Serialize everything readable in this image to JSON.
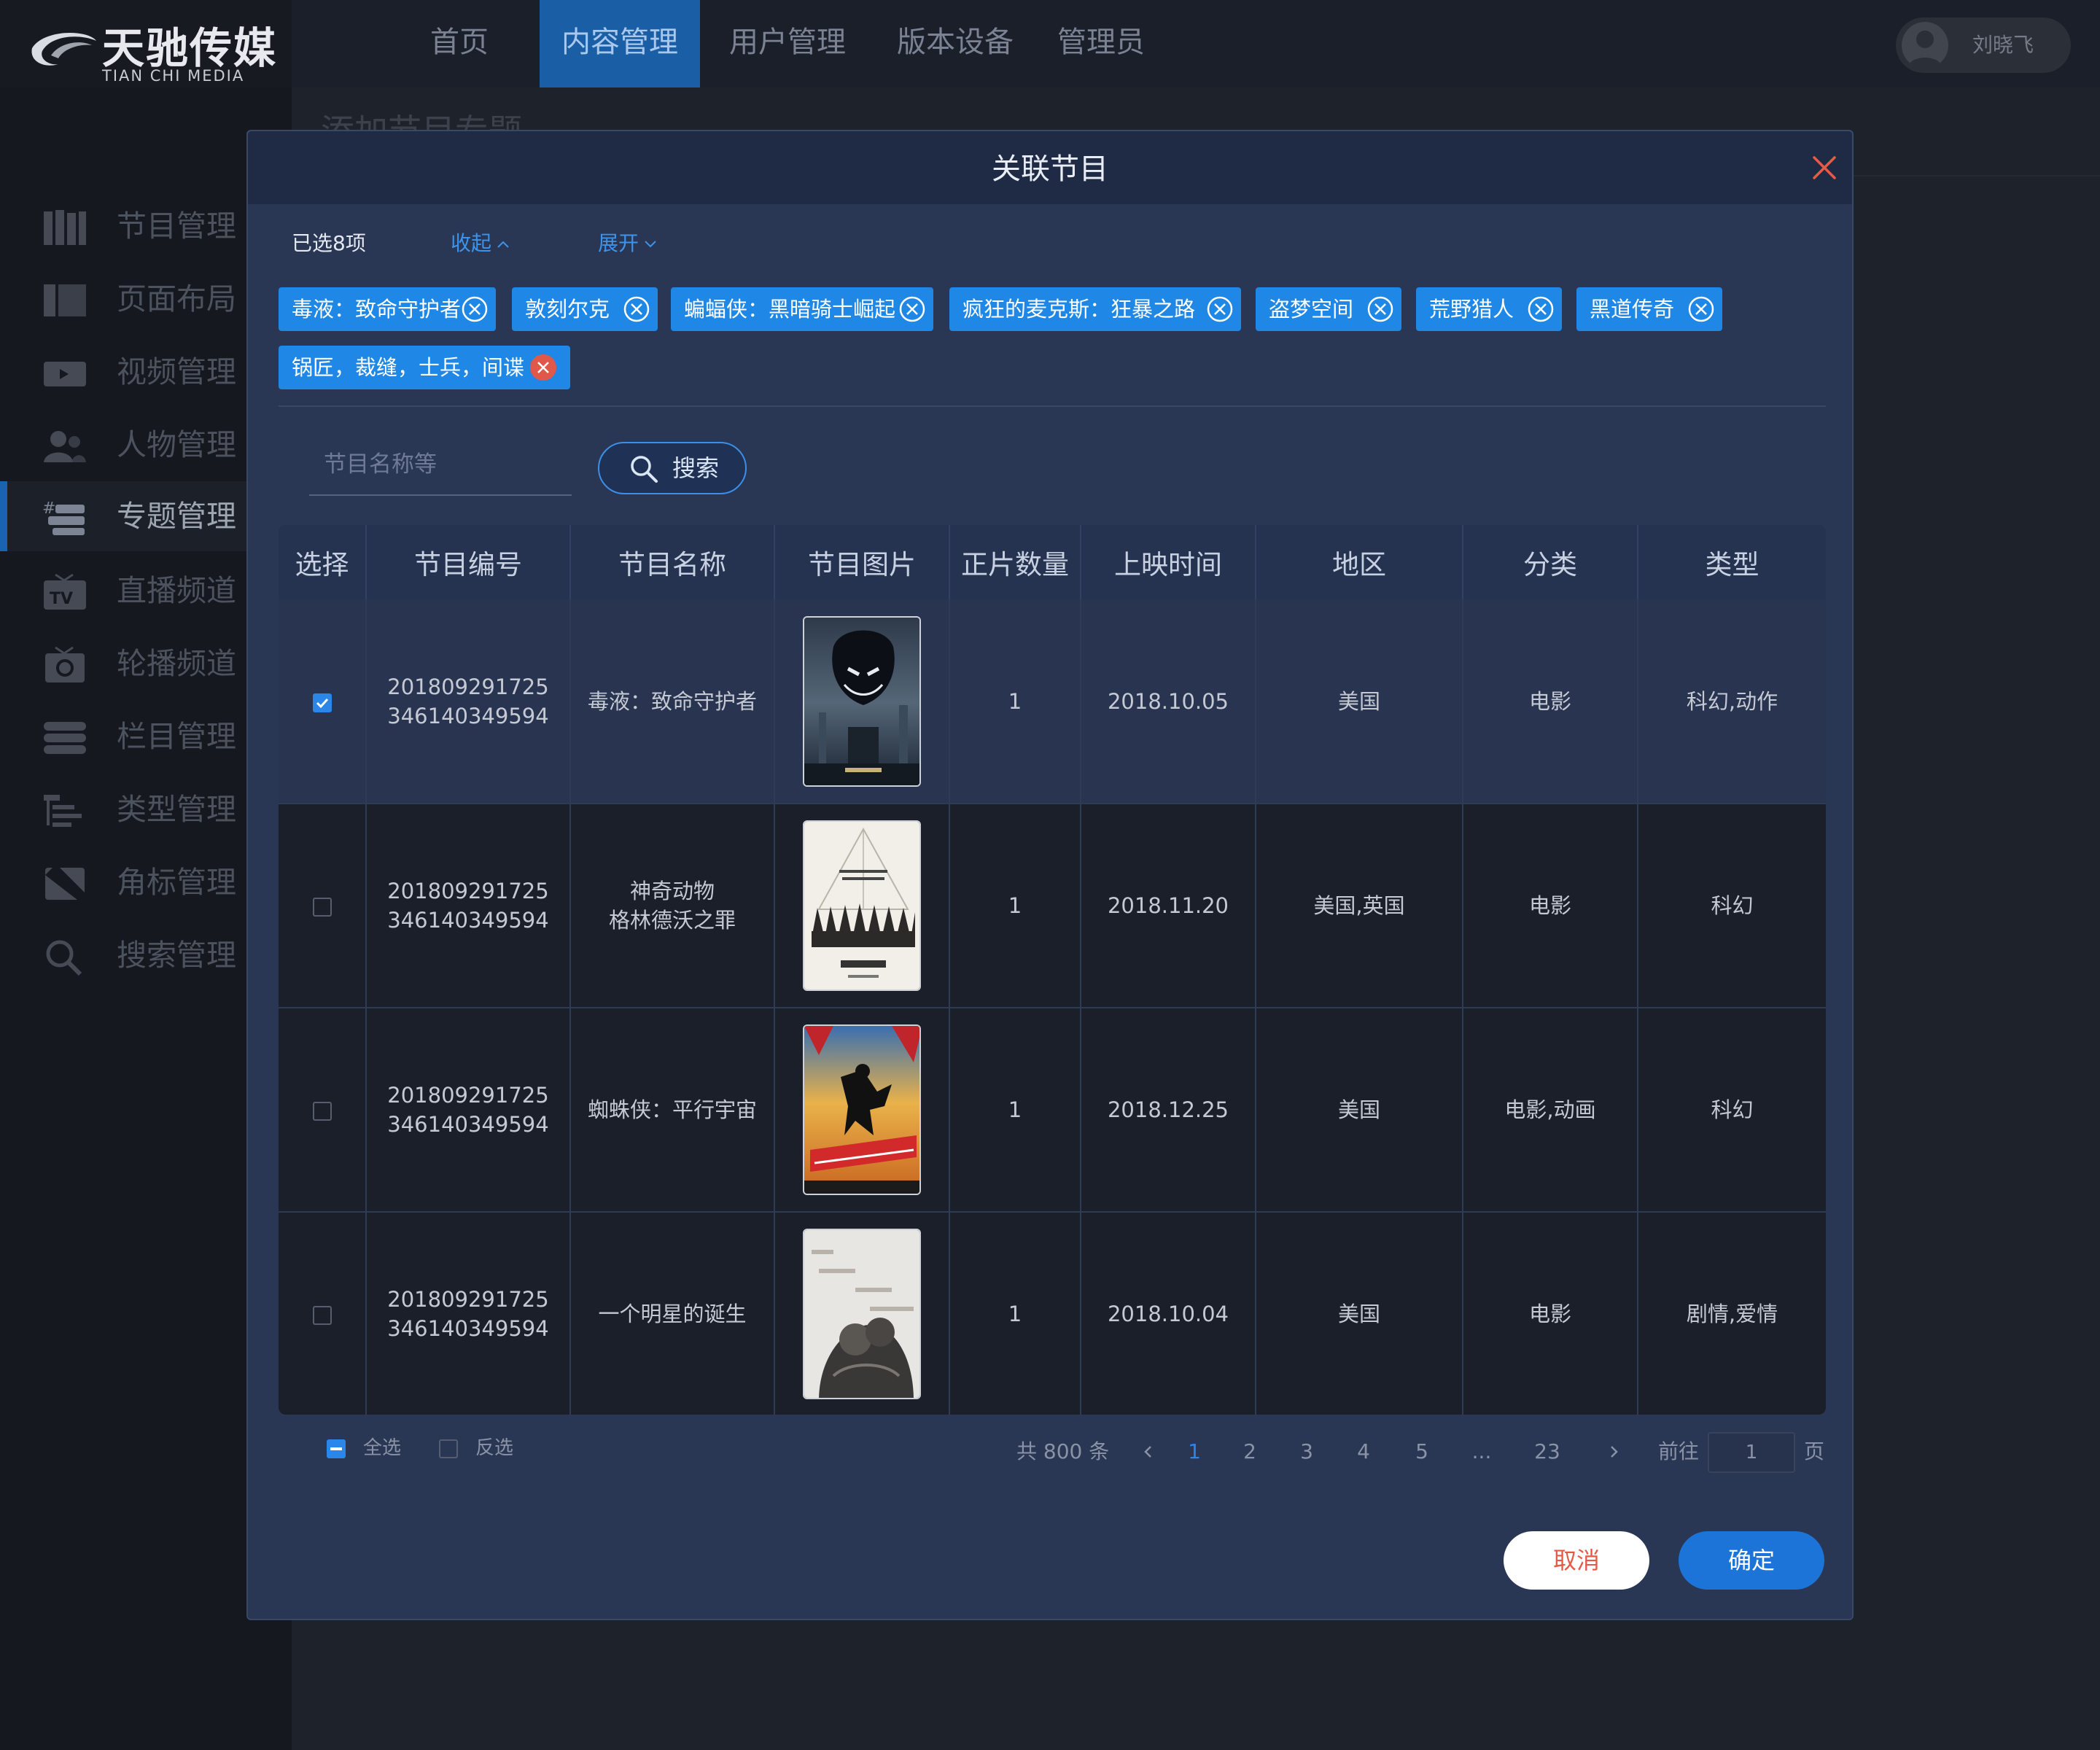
{
  "app": {
    "logo_title": "天驰传媒",
    "logo_sub": "TIAN CHI MEDIA"
  },
  "top_nav": [
    "首页",
    "内容管理",
    "用户管理",
    "版本设备",
    "管理员"
  ],
  "user": {
    "name": "刘晓飞"
  },
  "sidebar": {
    "items": [
      {
        "label": "节目管理",
        "icon": "film-icon"
      },
      {
        "label": "页面布局",
        "icon": "layout-icon"
      },
      {
        "label": "视频管理",
        "icon": "video-icon"
      },
      {
        "label": "人物管理",
        "icon": "people-icon"
      },
      {
        "label": "专题管理",
        "icon": "topic-icon"
      },
      {
        "label": "直播频道",
        "icon": "tv-icon"
      },
      {
        "label": "轮播频道",
        "icon": "carousel-icon"
      },
      {
        "label": "栏目管理",
        "icon": "column-icon"
      },
      {
        "label": "类型管理",
        "icon": "tree-icon"
      },
      {
        "label": "角标管理",
        "icon": "badge-icon"
      },
      {
        "label": "搜索管理",
        "icon": "search-icon"
      }
    ]
  },
  "background": {
    "page_title": "添加节目专题"
  },
  "modal": {
    "title": "关联节目",
    "selected_count": "已选8项",
    "collapse_label": "收起",
    "expand_label": "展开",
    "tags": [
      "毒液：致命守护者",
      "敦刻尔克",
      "蝙蝠侠：黑暗骑士崛起",
      "疯狂的麦克斯：狂暴之路",
      "盗梦空间",
      "荒野猎人",
      "黑道传奇",
      "锅匠，裁缝，士兵，间谍"
    ],
    "search": {
      "placeholder": "节目名称等",
      "button": "搜索"
    },
    "table": {
      "headers": [
        "选择",
        "节目编号",
        "节目名称",
        "节目图片",
        "正片数量",
        "上映时间",
        "地区",
        "分类",
        "类型"
      ],
      "rows": [
        {
          "id_line1": "201809291725",
          "id_line2": "346140349594",
          "name_line1": "毒液：致命守护者",
          "name_line2": "",
          "count": "1",
          "date": "2018.10.05",
          "region": "美国",
          "category": "电影",
          "genre": "科幻,动作",
          "checked": true
        },
        {
          "id_line1": "201809291725",
          "id_line2": "346140349594",
          "name_line1": "神奇动物",
          "name_line2": "格林德沃之罪",
          "count": "1",
          "date": "2018.11.20",
          "region": "美国,英国",
          "category": "电影",
          "genre": "科幻",
          "checked": false
        },
        {
          "id_line1": "201809291725",
          "id_line2": "346140349594",
          "name_line1": "蜘蛛侠：平行宇宙",
          "name_line2": "",
          "count": "1",
          "date": "2018.12.25",
          "region": "美国",
          "category": "电影,动画",
          "genre": "科幻",
          "checked": false
        },
        {
          "id_line1": "201809291725",
          "id_line2": "346140349594",
          "name_line1": "一个明星的诞生",
          "name_line2": "",
          "count": "1",
          "date": "2018.10.04",
          "region": "美国",
          "category": "电影",
          "genre": "剧情,爱情",
          "checked": false
        }
      ]
    },
    "footer": {
      "select_all": "全选",
      "invert": "反选",
      "total": "共 800 条",
      "pages": [
        "1",
        "2",
        "3",
        "4",
        "5",
        "...",
        "23"
      ],
      "current_page": "1",
      "goto_label": "前往",
      "goto_value": "1",
      "page_unit": "页"
    },
    "cancel": "取消",
    "confirm": "确定"
  },
  "colors": {
    "accent": "#1f87e6",
    "modal_bg": "#293654",
    "cancel_text": "#e55a47"
  }
}
